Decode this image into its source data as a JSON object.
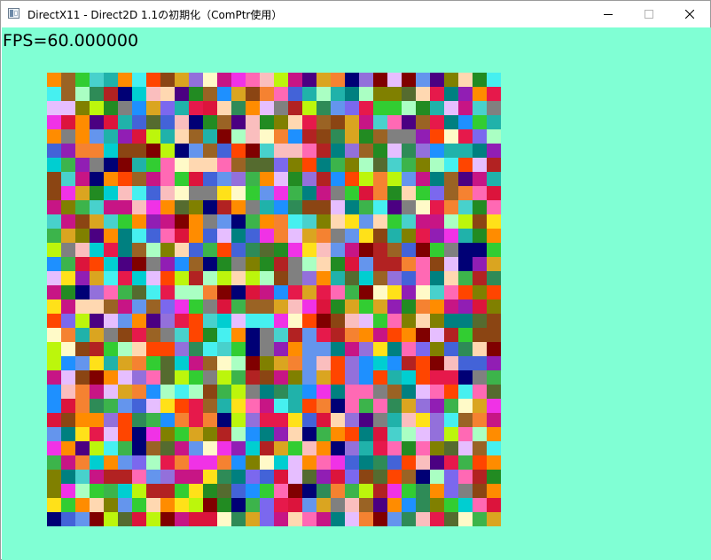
{
  "window": {
    "title": "DirectX11 - Direct2D 1.1の初期化（ComPtr使用）",
    "icon": "app-window-icon"
  },
  "caption_buttons": {
    "minimize_icon": "minimize-icon",
    "maximize_icon": "maximize-icon",
    "close_icon": "close-icon"
  },
  "client": {
    "background": "#80ffd4",
    "fps_text": "FPS=60.000000"
  },
  "tile_grid": {
    "rows": 32,
    "cols": 32,
    "palette": [
      "#e6194b",
      "#3cb44b",
      "#ffe119",
      "#4363d8",
      "#f58231",
      "#911eb4",
      "#46f0f0",
      "#f032e6",
      "#bcf60c",
      "#fabebe",
      "#008080",
      "#e6beff",
      "#9a6324",
      "#fffac8",
      "#800000",
      "#aaffc3",
      "#808000",
      "#ffd8b1",
      "#000075",
      "#808080",
      "#2e8b57",
      "#1e90ff",
      "#dc143c",
      "#ff69b4",
      "#7b68ee",
      "#32cd32",
      "#ff8c00",
      "#20b2aa",
      "#8b4513",
      "#9370db",
      "#00ced1",
      "#c71585",
      "#228b22",
      "#daa520",
      "#4b0082",
      "#ff4500",
      "#6495ed",
      "#556b2f",
      "#b22222",
      "#48d1cc"
    ]
  }
}
